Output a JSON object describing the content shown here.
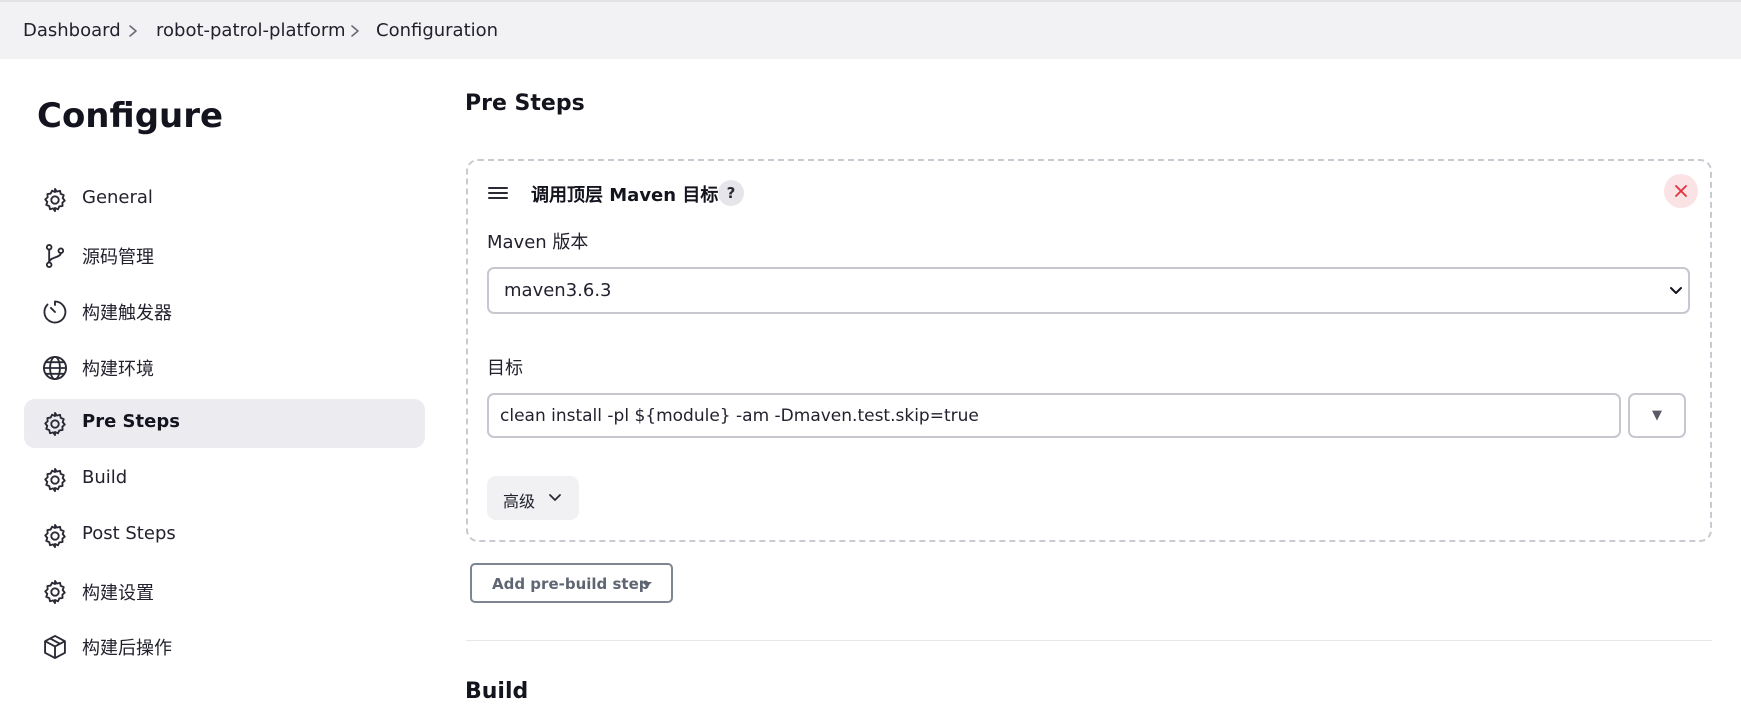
{
  "breadcrumb": {
    "items": [
      "Dashboard",
      "robot-patrol-platform",
      "Configuration"
    ]
  },
  "sidebar": {
    "title": "Configure",
    "items": [
      {
        "label": "General",
        "icon": "gear-icon",
        "active": false
      },
      {
        "label": "源码管理",
        "icon": "git-branch-icon",
        "active": false
      },
      {
        "label": "构建触发器",
        "icon": "timer-icon",
        "active": false
      },
      {
        "label": "构建环境",
        "icon": "globe-icon",
        "active": false
      },
      {
        "label": "Pre Steps",
        "icon": "gear-icon",
        "active": true
      },
      {
        "label": "Build",
        "icon": "gear-icon",
        "active": false
      },
      {
        "label": "Post Steps",
        "icon": "gear-icon",
        "active": false
      },
      {
        "label": "构建设置",
        "icon": "gear-icon",
        "active": false
      },
      {
        "label": "构建后操作",
        "icon": "package-icon",
        "active": false
      }
    ]
  },
  "main": {
    "section_title": "Pre Steps",
    "step": {
      "title": "调用顶层 Maven 目标",
      "help": "?",
      "maven_version_label": "Maven 版本",
      "maven_version_value": "maven3.6.3",
      "goals_label": "目标",
      "goals_value": "clean install -pl ${module} -am -Dmaven.test.skip=true",
      "dropdown_glyph": "▼",
      "advanced_label": "高级"
    },
    "add_step_label": "Add pre-build step",
    "next_section_title": "Build"
  },
  "colors": {
    "active_nav_bg": "#ebebf0",
    "close_bg": "#fbe2e4",
    "close_x": "#e0303a"
  }
}
